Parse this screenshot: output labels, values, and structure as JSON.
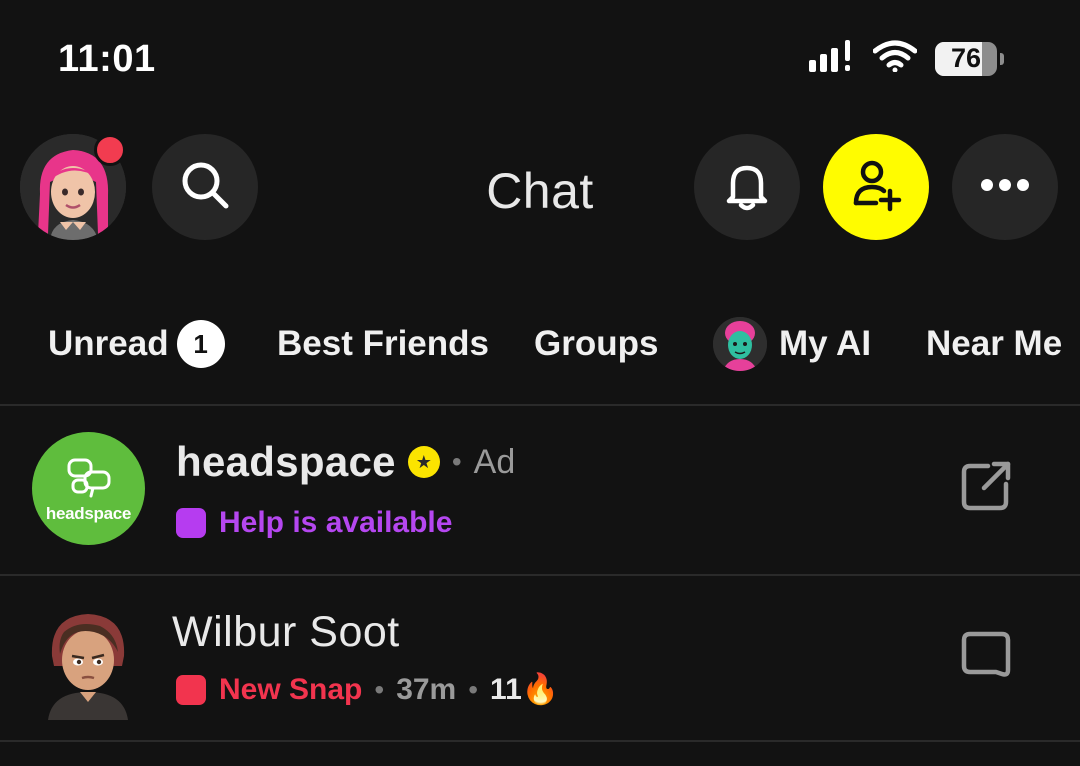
{
  "status_bar": {
    "time": "11:01",
    "battery": "76",
    "battery_level_percent": 76,
    "icons": [
      "cellular-signal-icon",
      "wifi-icon",
      "battery-icon"
    ]
  },
  "header": {
    "title": "Chat",
    "buttons": [
      "profile-avatar",
      "search-icon",
      "bell-icon",
      "add-friend-icon",
      "more-icon"
    ],
    "accent_color": "#fffc00",
    "notification_dot_color": "#f23c50"
  },
  "tabs": {
    "unread": "Unread",
    "unread_count": "1",
    "best_friends": "Best Friends",
    "groups": "Groups",
    "my_ai": "My AI",
    "near_me": "Near Me"
  },
  "chats": {
    "ad": {
      "logo_text": "headspace",
      "name": "headspace",
      "sponsor_tag": "Ad",
      "subtitle": "Help is available",
      "subtitle_color": "#b547f0",
      "action_icon": "external-link-icon"
    },
    "wilbur": {
      "name": "Wilbur Soot",
      "status": "New Snap",
      "status_color": "#f2344e",
      "time": "37m",
      "streak": "11",
      "streak_icon": "🔥",
      "action_icon": "chat-bubble-icon"
    }
  }
}
